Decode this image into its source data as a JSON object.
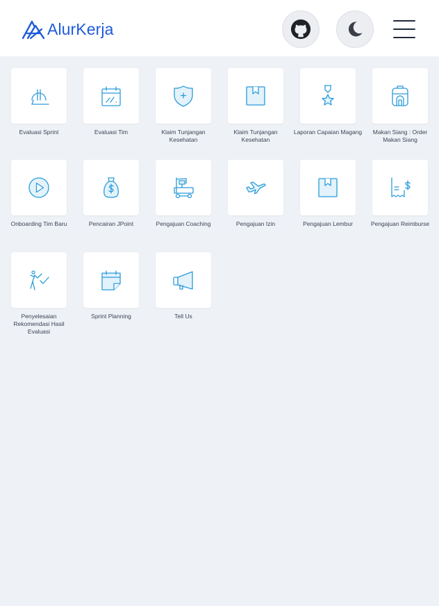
{
  "brand": {
    "name": "AlurKerja"
  },
  "header": {
    "github": "github-icon",
    "theme": "moon-icon",
    "menu": "hamburger-icon"
  },
  "icon_color": "#2a9bd9",
  "tiles": [
    {
      "label": "Evaluasi Sprint",
      "icon": "sprint-icon"
    },
    {
      "label": "Evaluasi Tim",
      "icon": "calendar-chart-icon"
    },
    {
      "label": "Klaim Tunjangan Kesehatan",
      "icon": "shield-plus-icon"
    },
    {
      "label": "Klaim Tunjangan Kesehatan",
      "icon": "bookmark-box-icon"
    },
    {
      "label": "Laporan Capaian Magang",
      "icon": "medal-icon"
    },
    {
      "label": "Makan Siang : Order Makan Siang",
      "icon": "lunchbox-icon"
    },
    {
      "label": "Onboarding Tim Baru",
      "icon": "play-icon"
    },
    {
      "label": "Pencairan JPoint",
      "icon": "money-bag-icon"
    },
    {
      "label": "Pengajuan Coaching",
      "icon": "forklift-icon"
    },
    {
      "label": "Pengajuan Izin",
      "icon": "airplane-icon"
    },
    {
      "label": "Pengajuan Lembur",
      "icon": "bookmark-box-icon"
    },
    {
      "label": "Pengajuan Reimburse",
      "icon": "receipt-icon"
    },
    {
      "label": "Penyelesaian Rekomendasi Hasil Evaluasi",
      "icon": "stickman-check-icon"
    },
    {
      "label": "Sprint Planning",
      "icon": "calendar-note-icon"
    },
    {
      "label": "Tell Us",
      "icon": "megaphone-icon"
    }
  ]
}
